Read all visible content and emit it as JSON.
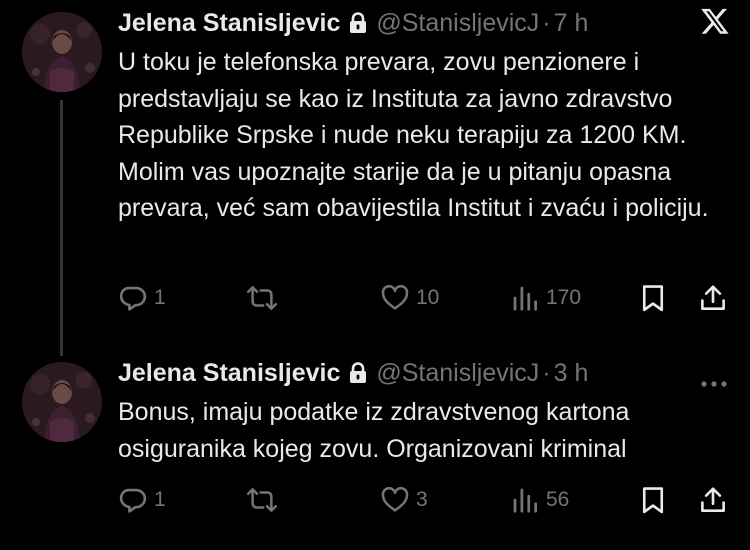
{
  "tweets": [
    {
      "author_name": "Jelena Stanisljevic",
      "handle": "@StanisljevicJ",
      "separator": "·",
      "time": "7 h",
      "text": "U toku je telefonska prevara, zovu penzionere i predstavljaju se kao iz Instituta za javno zdravstvo Republike Srpske i nude neku terapiju za 1200 KM. Molim vas upoznajte starije da je u pitanju opasna prevara, već sam obavijestila Institut i zvaću i policiju.",
      "replies": "1",
      "reposts": "",
      "likes": "10",
      "views": "170"
    },
    {
      "author_name": "Jelena Stanisljevic",
      "handle": "@StanisljevicJ",
      "separator": "·",
      "time": "3 h",
      "text": "Bonus, imaju podatke iz zdravstvenog kartona osiguranika kojeg zovu. Organizovani kriminal",
      "replies": "1",
      "reposts": "",
      "likes": "3",
      "views": "56"
    }
  ],
  "icons": {
    "top_right": "x-logo-icon",
    "more": "more-options-icon",
    "reply": "reply-icon",
    "repost": "repost-icon",
    "like": "heart-icon",
    "views": "views-icon",
    "bookmark": "bookmark-icon",
    "share": "share-icon",
    "lock": "lock-icon"
  },
  "colors": {
    "background": "#000000",
    "text": "#e7e9ea",
    "secondary": "#71767b",
    "thread_line": "#333639"
  }
}
